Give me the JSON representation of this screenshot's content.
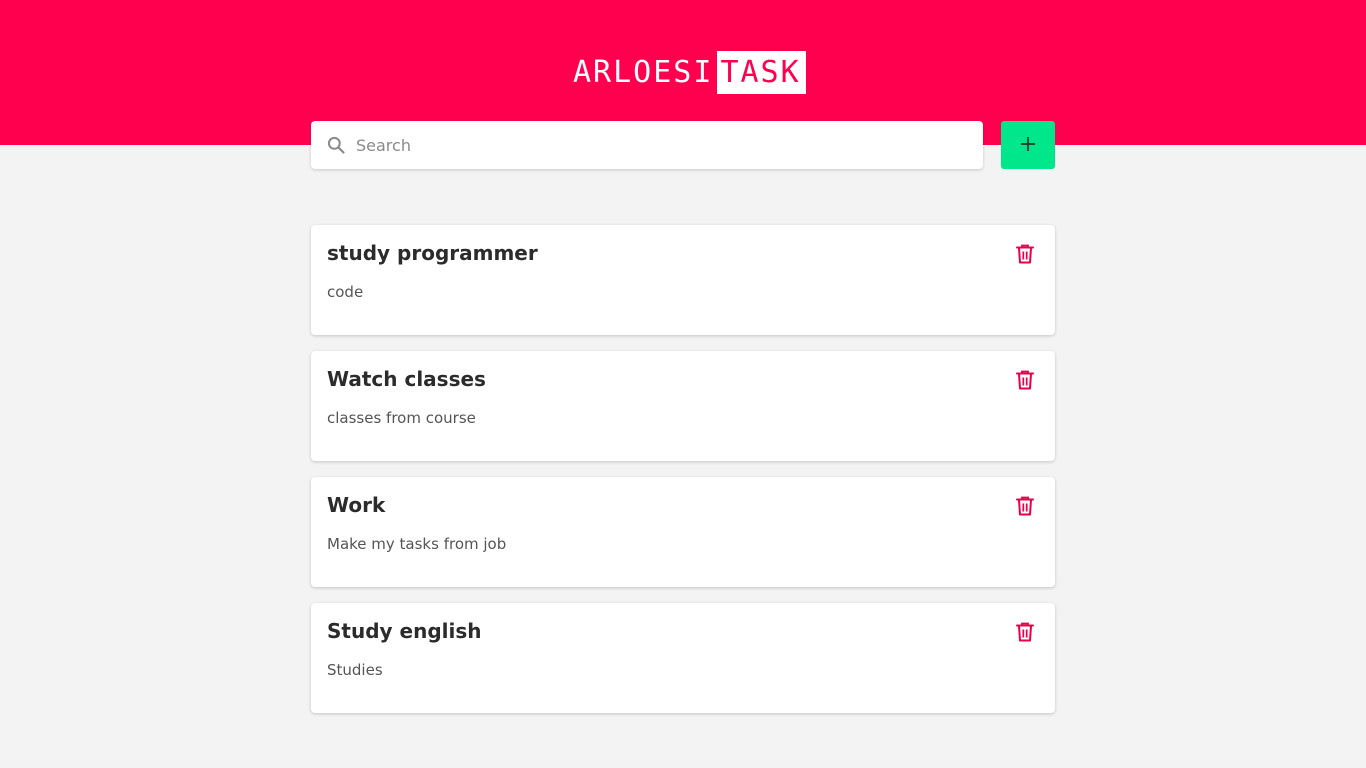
{
  "app": {
    "logo_part1": "ARLOESI",
    "logo_part2": "TASK"
  },
  "colors": {
    "brand": "#ff004f",
    "add_button": "#00e68a",
    "background": "#f4f3f4"
  },
  "search": {
    "placeholder": "Search",
    "value": "",
    "icon": "search-icon"
  },
  "add_button": {
    "icon": "plus-icon"
  },
  "tasks": [
    {
      "title": "study programmer",
      "description": "code",
      "delete_icon": "trash-icon"
    },
    {
      "title": "Watch classes",
      "description": "classes from course",
      "delete_icon": "trash-icon"
    },
    {
      "title": "Work",
      "description": "Make my tasks from job",
      "delete_icon": "trash-icon"
    },
    {
      "title": "Study english",
      "description": "Studies",
      "delete_icon": "trash-icon"
    }
  ]
}
